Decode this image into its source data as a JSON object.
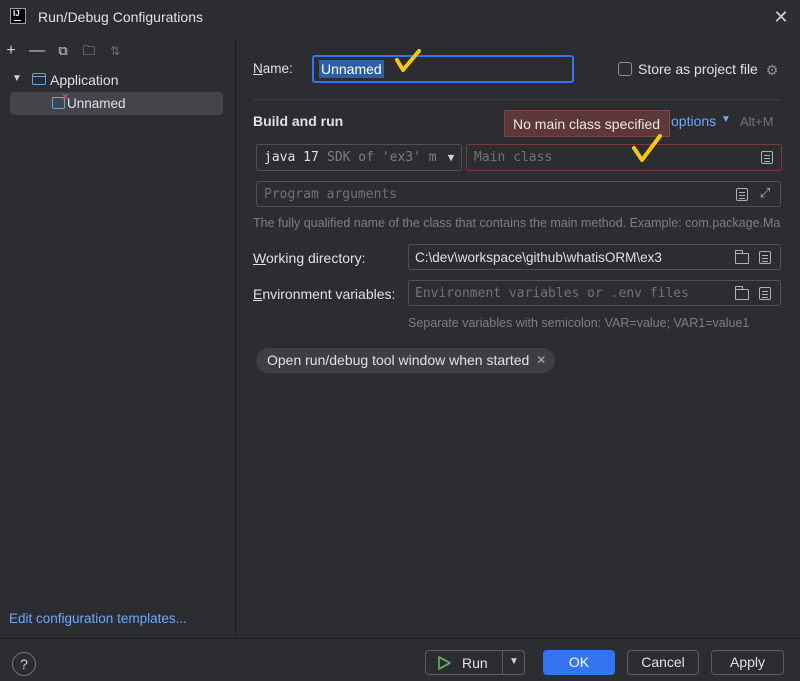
{
  "window": {
    "app_logo_text": "IJ",
    "title": "Run/Debug Configurations"
  },
  "toolbar": {
    "icons": [
      "add-icon",
      "remove-icon",
      "copy-icon",
      "new-folder-icon",
      "sort-icon"
    ]
  },
  "tree": {
    "group_label": "Application",
    "item_label": "Unnamed"
  },
  "edit_templates_link": "Edit configuration templates...",
  "form": {
    "name_label": "Name:",
    "name_value": "Unnamed",
    "store_label": "Store as project file",
    "store_checked": false,
    "build_run_heading": "Build and run",
    "error_tooltip": "No main class specified",
    "modify_options_link": "options",
    "modify_shortcut": "Alt+M",
    "sdk_version": "java 17",
    "sdk_desc": "SDK of 'ex3' m",
    "main_class_placeholder": "Main class",
    "program_args_placeholder": "Program arguments",
    "main_class_hint": "The fully qualified name of the class that contains the main method. Example: com.package.Ma",
    "working_dir_label": "Working directory:",
    "working_dir_value": "C:\\dev\\workspace\\github\\whatisORM\\ex3",
    "env_label": "Environment variables:",
    "env_placeholder": "Environment variables or .env files",
    "env_hint": "Separate variables with semicolon: VAR=value; VAR1=value1",
    "chip_label": "Open run/debug tool window when started"
  },
  "buttons": {
    "help": "?",
    "run": "Run",
    "ok": "OK",
    "cancel": "Cancel",
    "apply": "Apply"
  },
  "colors": {
    "background": "#2b2d30",
    "accent": "#3574f0",
    "error": "#5e3838",
    "link": "#6ea8ff",
    "annotation_check": "#f5c518"
  }
}
